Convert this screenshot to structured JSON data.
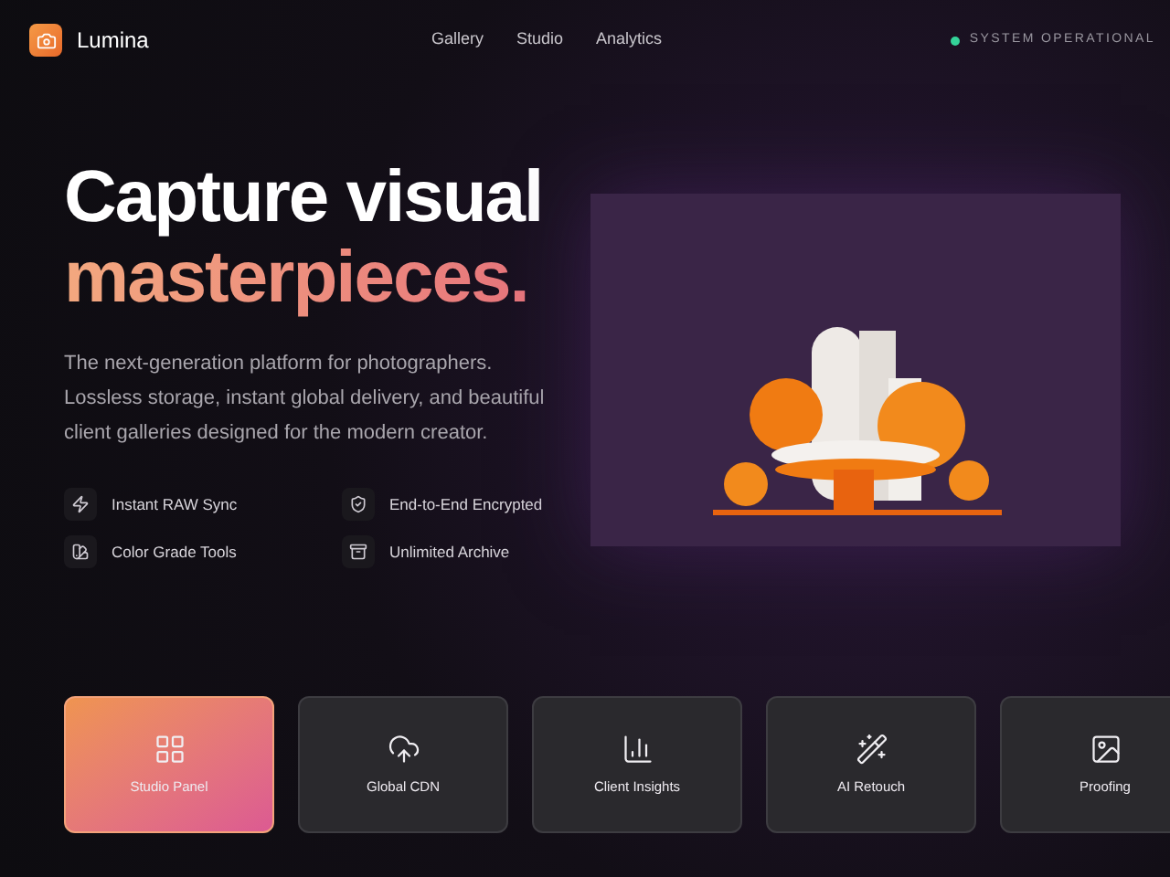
{
  "brand": {
    "name": "Lumina"
  },
  "nav": [
    {
      "label": "Gallery"
    },
    {
      "label": "Studio"
    },
    {
      "label": "Analytics"
    }
  ],
  "status": {
    "label": "SYSTEM OPERATIONAL",
    "color": "#34d399"
  },
  "hero": {
    "title_line1": "Capture visual",
    "title_line2": "masterpieces.",
    "description": "The next-generation platform for photographers. Lossless storage, instant global delivery, and beautiful client galleries designed for the modern creator."
  },
  "features": [
    {
      "label": "Instant RAW Sync"
    },
    {
      "label": "End-to-End Encrypted"
    },
    {
      "label": "Color Grade Tools"
    },
    {
      "label": "Unlimited Archive"
    }
  ],
  "tiles": [
    {
      "label": "Studio Panel",
      "selected": true
    },
    {
      "label": "Global CDN",
      "selected": false
    },
    {
      "label": "Client Insights",
      "selected": false
    },
    {
      "label": "AI Retouch",
      "selected": false
    },
    {
      "label": "Proofing",
      "selected": false
    }
  ]
}
